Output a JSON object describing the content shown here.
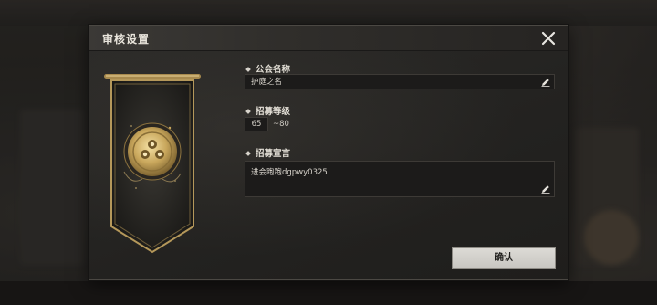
{
  "dialog": {
    "title": "审核设置",
    "close_icon": "close-icon"
  },
  "form": {
    "guild_name": {
      "label": "公会名称",
      "value": "护庭之名",
      "icon": "edit-icon"
    },
    "recruit_level": {
      "label": "招募等级",
      "value": "65",
      "max_text": "~80"
    },
    "recruit_declaration": {
      "label": "招募宣言",
      "value": "进会跑跑dgpwy0325",
      "icon": "edit-icon"
    }
  },
  "buttons": {
    "confirm_label": "确认"
  },
  "colors": {
    "banner_gold": "#c9a75c",
    "banner_dark": "#1b1a18",
    "button_bg": "#d6d4cf"
  }
}
